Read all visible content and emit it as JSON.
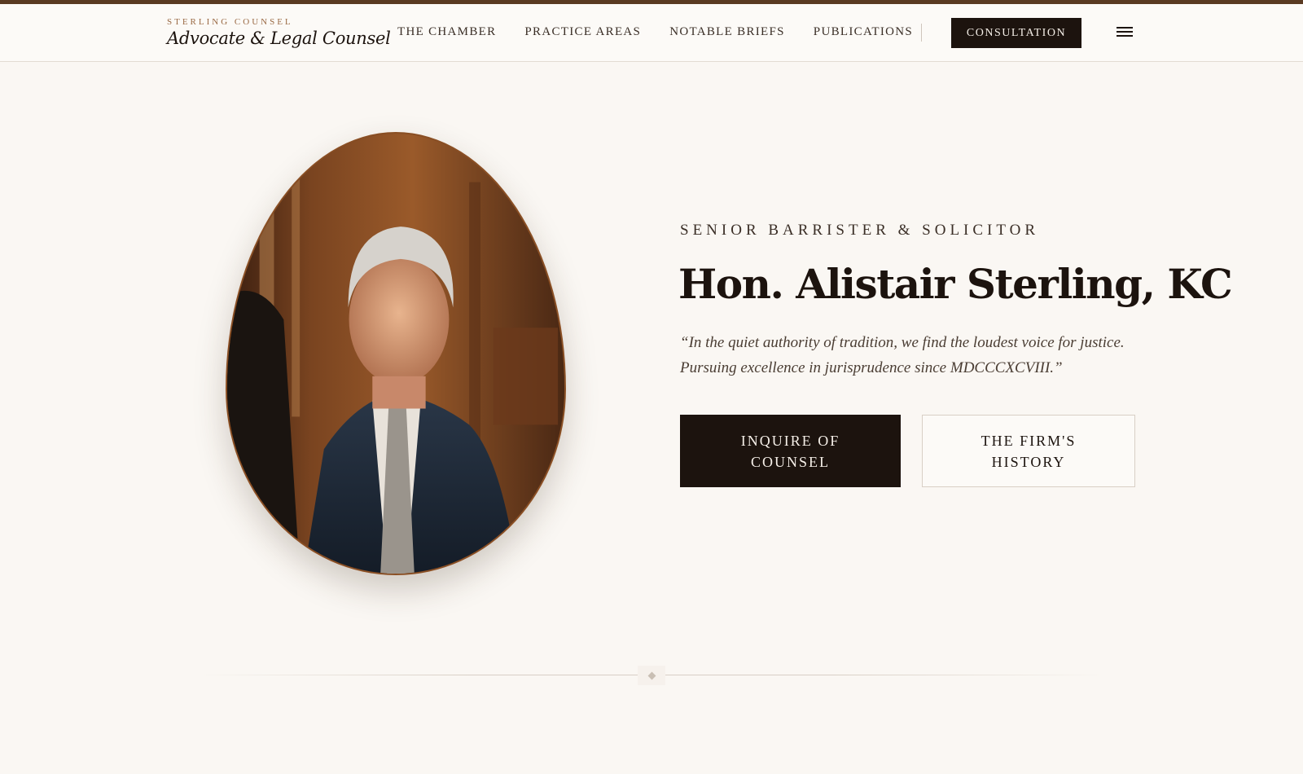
{
  "brand": {
    "tagline": "STERLING COUNSEL",
    "name": "Advocate & Legal Counsel"
  },
  "nav": {
    "items": [
      "THE CHAMBER",
      "PRACTICE AREAS",
      "NOTABLE BRIEFS",
      "PUBLICATIONS"
    ],
    "cta": "CONSULTATION"
  },
  "hero": {
    "eyebrow": "SENIOR BARRISTER & SOLICITOR",
    "title": "Hon. Alistair Sterling, KC",
    "quote": "“In the quiet authority of tradition, we find the loudest voice for justice. Pursuing excellence in jurisprudence since MDCCCXCVIII.”",
    "primary_button": "INQUIRE OF COUNSEL",
    "secondary_button": "THE FIRM'S HISTORY"
  },
  "icons": {
    "menu": "hamburger-menu-icon",
    "divider": "diamond-ornament-icon"
  },
  "colors": {
    "accent_bar": "#5a3a22",
    "dark": "#1c130e",
    "background": "#faf7f3",
    "brand_accent": "#9a6a45"
  }
}
